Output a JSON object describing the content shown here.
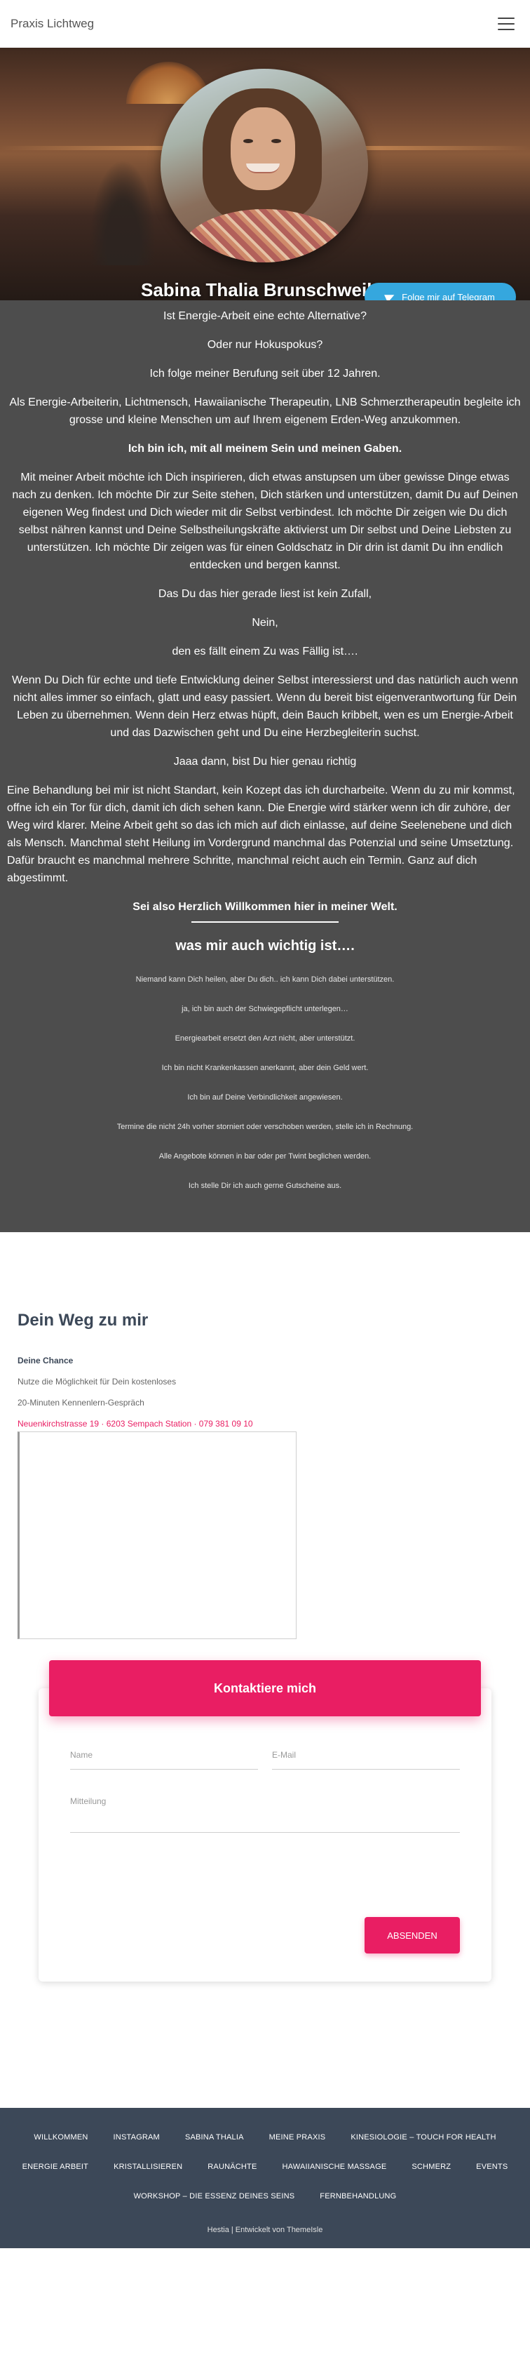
{
  "navbar": {
    "brand": "Praxis Lichtweg",
    "menu_icon": "hamburger-menu-icon"
  },
  "hero": {
    "name": "Sabina Thalia Brunschweiler",
    "telegram_label": "Folge mir auf Telegram",
    "telegram_icon": "telegram-plane-icon"
  },
  "intro": {
    "p1": "Ist Energie-Arbeit eine echte Alternative?",
    "p2": "Oder nur Hokuspokus?",
    "p3": "Ich folge meiner Berufung seit über 12 Jahren.",
    "p4": "Als Energie-Arbeiterin, Lichtmensch, Hawaiianische Therapeutin, LNB Schmerztherapeutin begleite ich grosse und kleine Menschen um auf Ihrem eigenem Erden-Weg anzukommen.",
    "p5": "Ich bin ich, mit all meinem Sein und meinen Gaben.",
    "p6": "Mit meiner Arbeit möchte ich Dich inspirieren, dich etwas anstupsen um über gewisse Dinge etwas nach zu denken. Ich möchte Dir zur Seite stehen, Dich stärken und unterstützen, damit Du auf Deinen eigenen Weg findest und Dich wieder mit dir Selbst verbindest. Ich möchte Dir zeigen wie Du dich selbst nähren kannst und Deine Selbstheilungskräfte aktivierst um Dir selbst und Deine Liebsten zu unterstützen. Ich möchte Dir zeigen was für einen Goldschatz in Dir drin ist damit Du ihn endlich entdecken und bergen kannst.",
    "p7": "Das Du das hier gerade liest ist kein Zufall,",
    "p8": "Nein,",
    "p9": "den es fällt einem Zu was Fällig ist….",
    "p10": "Wenn Du Dich für echte und tiefe Entwicklung deiner Selbst interessierst und das natürlich auch wenn nicht alles immer so einfach, glatt und easy passiert. Wenn du bereit bist eigenverantwortung für Dein Leben zu übernehmen. Wenn dein Herz etwas hüpft, dein Bauch kribbelt, wen es um Energie-Arbeit und das Dazwischen geht und Du eine Herzbegleiterin suchst.",
    "p11": "Jaaa dann, bist Du hier genau richtig",
    "p12": "Eine Behandlung bei mir ist nicht Standart, kein Kozept das ich durcharbeite. Wenn du zu mir kommst, offne ich ein Tor für dich, damit ich dich sehen kann. Die Energie wird stärker wenn ich dir zuhöre, der Weg wird klarer. Meine Arbeit geht so das ich mich auf dich einlasse, auf deine Seelenebene und dich als Mensch. Manchmal steht Heilung im Vordergrund manchmal das Potenzial und seine Umsetztung. Dafür braucht es manchmal mehrere Schritte, manchmal reicht auch ein Termin. Ganz auf dich abgestimmt.",
    "p13": "Sei also Herzlich Willkommen hier in meiner Welt.",
    "heading": "was mir auch wichtig ist….",
    "items": [
      "Niemand kann Dich heilen, aber Du dich.. ich kann Dich dabei unterstützen.",
      "ja, ich bin auch der Schwiegepflicht unterlegen…",
      "Energiearbeit ersetzt den Arzt nicht, aber unterstützt.",
      "Ich bin nicht Krankenkassen anerkannt, aber dein Geld wert.",
      "Ich bin auf Deine Verbindlichkeit angewiesen.",
      "Termine die nicht 24h vorher storniert oder verschoben werden, stelle ich in Rechnung.",
      "Alle Angebote können in bar oder per Twint beglichen werden.",
      "Ich stelle Dir ich auch gerne Gutscheine aus."
    ]
  },
  "weg": {
    "title": "Dein Weg zu mir",
    "chance": "Deine Chance",
    "line1": "Nutze die Möglichkeit für Dein kostenloses",
    "line2": "20-Minuten Kennenlern-Gespräch",
    "address": "Neuenkirchstrasse 19 · 6203 Sempach Station · 079 381 09 10"
  },
  "contact": {
    "title": "Kontaktiere mich",
    "name_placeholder": "Name",
    "email_placeholder": "E-Mail",
    "message_placeholder": "Mitteilung",
    "submit": "ABSENDEN"
  },
  "footer": {
    "links": [
      "WILLKOMMEN",
      "INSTAGRAM",
      "SABINA THALIA",
      "MEINE PRAXIS",
      "KINESIOLOGIE – TOUCH FOR HEALTH",
      "ENERGIE ARBEIT",
      "KRISTALLISIEREN",
      "RAUNÄCHTE",
      "HAWAIIANISCHE MASSAGE",
      "SCHMERZ",
      "EVENTS",
      "WORKSHOP – DIE ESSENZ DEINES SEINS",
      "FERNBEHANDLUNG"
    ],
    "credit": "Hestia | Entwickelt von ThemeIsle"
  },
  "colors": {
    "accent": "#e91e63",
    "telegram": "#35a7de",
    "intro_bg": "#4d4d4d",
    "footer_bg": "#3c4858"
  }
}
